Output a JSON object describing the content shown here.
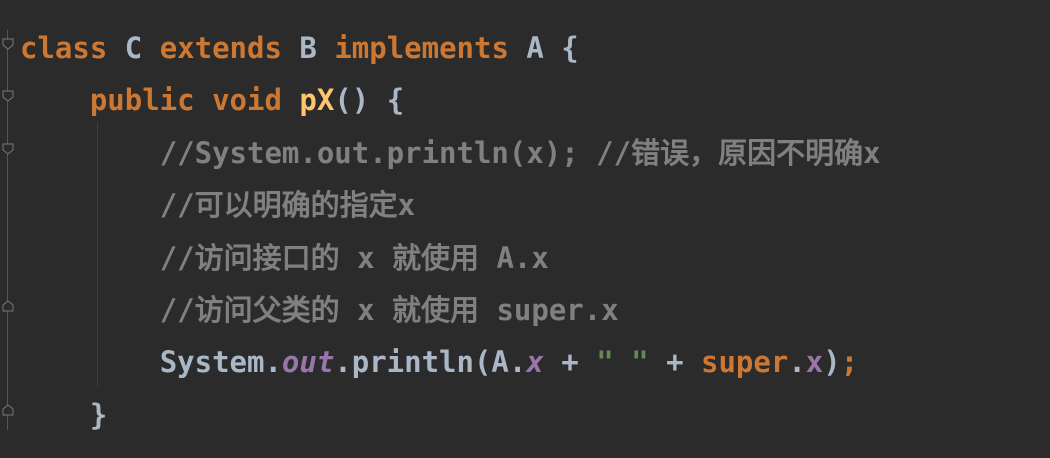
{
  "editor": {
    "lines": [
      {
        "indent": "",
        "tokens": [
          {
            "t": "class",
            "k": "kw"
          },
          {
            "t": " C ",
            "k": "pl"
          },
          {
            "t": "extends",
            "k": "kw"
          },
          {
            "t": " B ",
            "k": "pl"
          },
          {
            "t": "implements",
            "k": "kw"
          },
          {
            "t": " A {",
            "k": "pl"
          }
        ]
      },
      {
        "indent": "    ",
        "tokens": [
          {
            "t": "public",
            "k": "kw"
          },
          {
            "t": " ",
            "k": "pl"
          },
          {
            "t": "void",
            "k": "kw"
          },
          {
            "t": " ",
            "k": "pl"
          },
          {
            "t": "pX",
            "k": "fn"
          },
          {
            "t": "() {",
            "k": "pl"
          }
        ]
      },
      {
        "indent": "        ",
        "tokens": [
          {
            "t": "//System.out.println(x); //错误，原因不明确x",
            "k": "cm"
          }
        ]
      },
      {
        "indent": "        ",
        "tokens": [
          {
            "t": "//可以明确的指定x",
            "k": "cm"
          }
        ]
      },
      {
        "indent": "        ",
        "tokens": [
          {
            "t": "//访问接口的 x 就使用 A.x",
            "k": "cm"
          }
        ]
      },
      {
        "indent": "        ",
        "tokens": [
          {
            "t": "//访问父类的 x 就使用 super.x",
            "k": "cm"
          }
        ]
      },
      {
        "indent": "        ",
        "tokens": [
          {
            "t": "System.",
            "k": "pl"
          },
          {
            "t": "out",
            "k": "fld"
          },
          {
            "t": ".println(A.",
            "k": "pl"
          },
          {
            "t": "x",
            "k": "fld"
          },
          {
            "t": " + ",
            "k": "pl"
          },
          {
            "t": "\" \"",
            "k": "str"
          },
          {
            "t": " + ",
            "k": "pl"
          },
          {
            "t": "super",
            "k": "kw"
          },
          {
            "t": ".",
            "k": "pl"
          },
          {
            "t": "x",
            "k": "fldp"
          },
          {
            "t": ")",
            "k": "pl"
          },
          {
            "t": ";",
            "k": "kw"
          }
        ]
      },
      {
        "indent": "    ",
        "tokens": [
          {
            "t": "}",
            "k": "pl"
          }
        ]
      }
    ]
  },
  "colors": {
    "background": "#2b2b2b",
    "keyword": "#cc7832",
    "method_declaration": "#ffc66d",
    "comment": "#808080",
    "field": "#9876aa",
    "string": "#6a8759",
    "default_text": "#a9b7c6"
  },
  "gutter": {
    "icons": [
      "fold-collapse-icon",
      "fold-collapse-icon",
      "fold-collapse-icon",
      "fold-end-icon",
      "fold-end-icon"
    ]
  }
}
